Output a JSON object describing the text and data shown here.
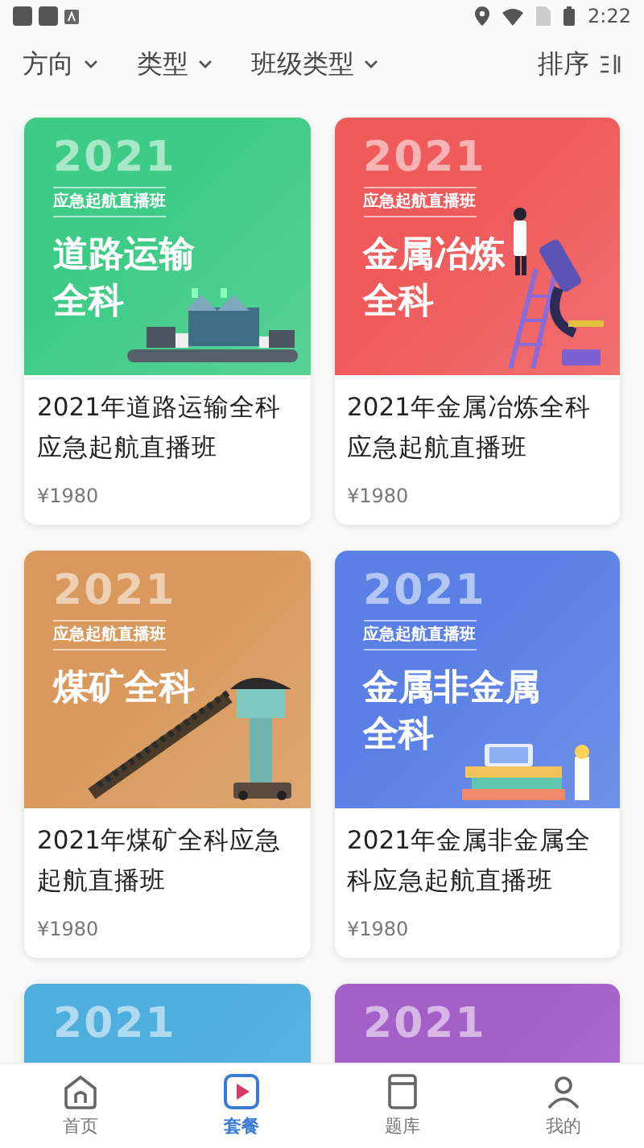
{
  "status_bar": {
    "time": "2:22"
  },
  "filters": [
    {
      "label": "方向"
    },
    {
      "label": "类型"
    },
    {
      "label": "班级类型"
    }
  ],
  "sort": {
    "label": "排序"
  },
  "courses": [
    {
      "color": "#3ecb86",
      "kind": "warehouse",
      "banner_year": "2021",
      "banner_tag": "应急起航直播班",
      "banner_title": [
        "道路运输",
        "全科"
      ],
      "title": "2021年道路运输全科应急起航直播班",
      "price": "¥1980"
    },
    {
      "color": "#ef5a5a",
      "kind": "microscope",
      "banner_year": "2021",
      "banner_tag": "应急起航直播班",
      "banner_title": [
        "金属冶炼",
        "全科"
      ],
      "title": "2021年金属冶炼全科应急起航直播班",
      "price": "¥1980"
    },
    {
      "color": "#d9995c",
      "kind": "conveyor",
      "banner_year": "2021",
      "banner_tag": "应急起航直播班",
      "banner_title": [
        "煤矿全科"
      ],
      "title": "2021年煤矿全科应急起航直播班",
      "price": "¥1980"
    },
    {
      "color": "#5a80e6",
      "kind": "books",
      "banner_year": "2021",
      "banner_tag": "应急起航直播班",
      "banner_title": [
        "金属非金属",
        "全科"
      ],
      "title": "2021年金属非金属全科应急起航直播班",
      "price": "¥1980"
    },
    {
      "color": "#4eaede",
      "banner_year": "2021"
    },
    {
      "color": "#a45fc8",
      "banner_year": "2021"
    }
  ],
  "tabs": [
    {
      "label": "首页",
      "selected": false
    },
    {
      "label": "套餐",
      "selected": true
    },
    {
      "label": "题库",
      "selected": false
    },
    {
      "label": "我的",
      "selected": false
    }
  ]
}
